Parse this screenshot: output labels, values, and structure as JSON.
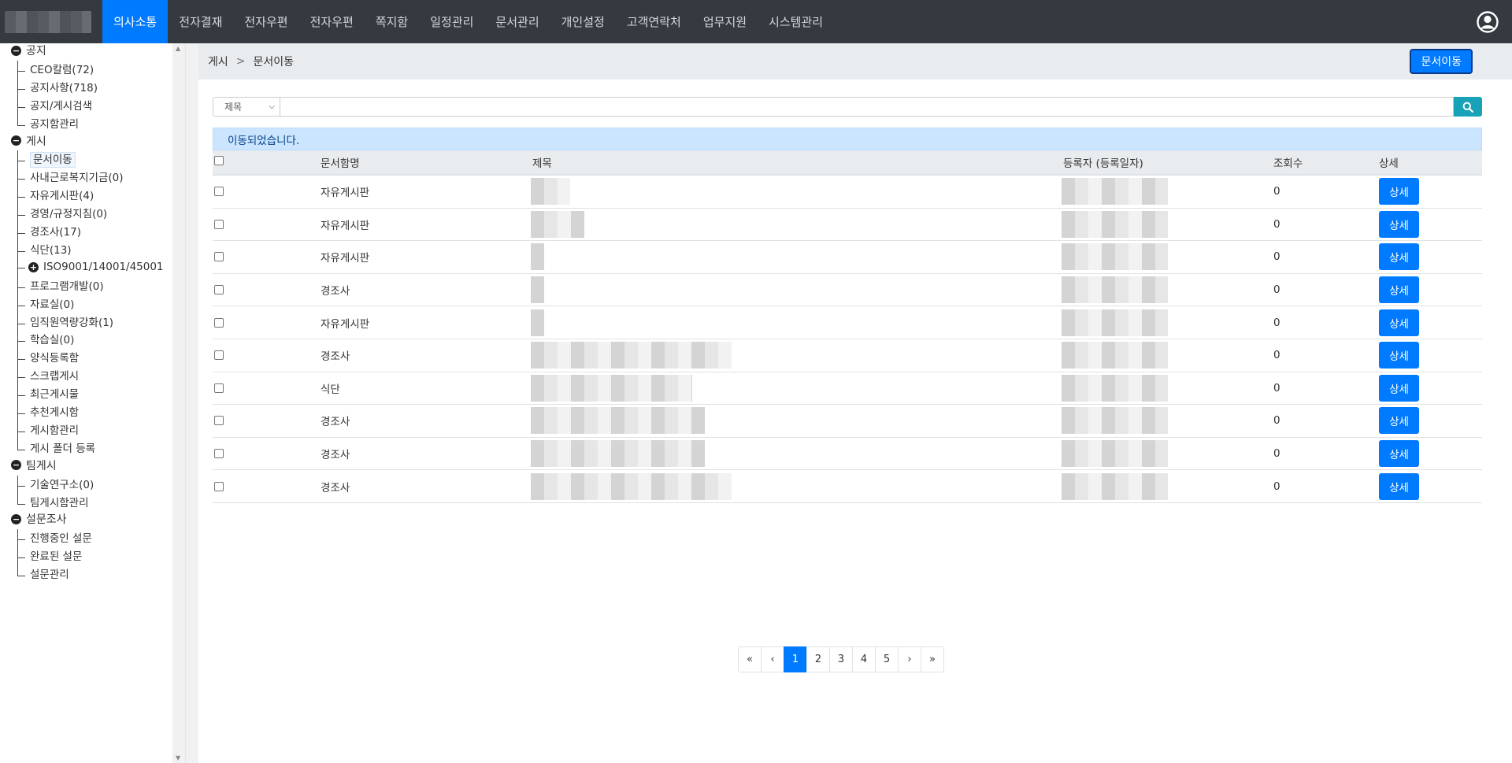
{
  "topnav": {
    "menu": [
      "의사소통",
      "전자결재",
      "전자우편",
      "전자우편",
      "쪽지함",
      "일정관리",
      "문서관리",
      "개인설정",
      "고객연락처",
      "업무지원",
      "시스템관리"
    ],
    "active_index": 0
  },
  "sidebar": {
    "groups": [
      {
        "label": "공지",
        "items": [
          "CEO칼럼(72)",
          "공지사항(718)",
          "공지/게시검색",
          "공지함관리"
        ]
      },
      {
        "label": "게시",
        "items": [
          "문서이동",
          "사내근로복지기금(0)",
          "자유게시판(4)",
          "경영/규정지침(0)",
          "경조사(17)",
          "식단(13)",
          "ISO9001/14001/45001",
          "프로그램개발(0)",
          "자료실(0)",
          "임직원역량강화(1)",
          "학습실(0)",
          "양식등록함",
          "스크랩게시",
          "최근게시물",
          "추천게시함",
          "게시함관리",
          "게시 폴더 등록"
        ]
      },
      {
        "label": "팀게시",
        "items": [
          "기술연구소(0)",
          "팀게시함관리"
        ]
      },
      {
        "label": "설문조사",
        "items": [
          "진행중인 설문",
          "완료된 설문",
          "설문관리"
        ]
      }
    ],
    "active_item": "문서이동"
  },
  "breadcrumb": {
    "parent": "게시",
    "separator": ">",
    "current": "문서이동"
  },
  "move_button": "문서이동",
  "search": {
    "select_value": "제목",
    "input_value": ""
  },
  "alert": "이동되었습니다.",
  "table": {
    "headers": {
      "category": "문서함명",
      "title": "제목",
      "registrant": "등록자 (등록일자)",
      "views": "조회수",
      "detail": "상세"
    },
    "rows": [
      {
        "category": "자유게시판",
        "views": "0",
        "detail": "상세",
        "title_w": 50
      },
      {
        "category": "자유게시판",
        "views": "0",
        "detail": "상세",
        "title_w": 68
      },
      {
        "category": "자유게시판",
        "views": "0",
        "detail": "상세",
        "title_w": 17
      },
      {
        "category": "경조사",
        "views": "0",
        "detail": "상세",
        "title_w": 17
      },
      {
        "category": "자유게시판",
        "views": "0",
        "detail": "상세",
        "title_w": 17
      },
      {
        "category": "경조사",
        "views": "0",
        "detail": "상세",
        "title_w": 255
      },
      {
        "category": "식단",
        "views": "0",
        "detail": "상세",
        "title_w": 205
      },
      {
        "category": "경조사",
        "views": "0",
        "detail": "상세",
        "title_w": 221
      },
      {
        "category": "경조사",
        "views": "0",
        "detail": "상세",
        "title_w": 221
      },
      {
        "category": "경조사",
        "views": "0",
        "detail": "상세",
        "title_w": 255
      }
    ]
  },
  "pagination": {
    "first": "«",
    "prev": "‹",
    "pages": [
      "1",
      "2",
      "3",
      "4",
      "5"
    ],
    "active": "1",
    "next": "›",
    "last": "»"
  },
  "icons": {
    "search": "search-icon",
    "user": "user-circle-icon",
    "collapse": "minus-circle-icon",
    "expand": "plus-circle-icon"
  }
}
